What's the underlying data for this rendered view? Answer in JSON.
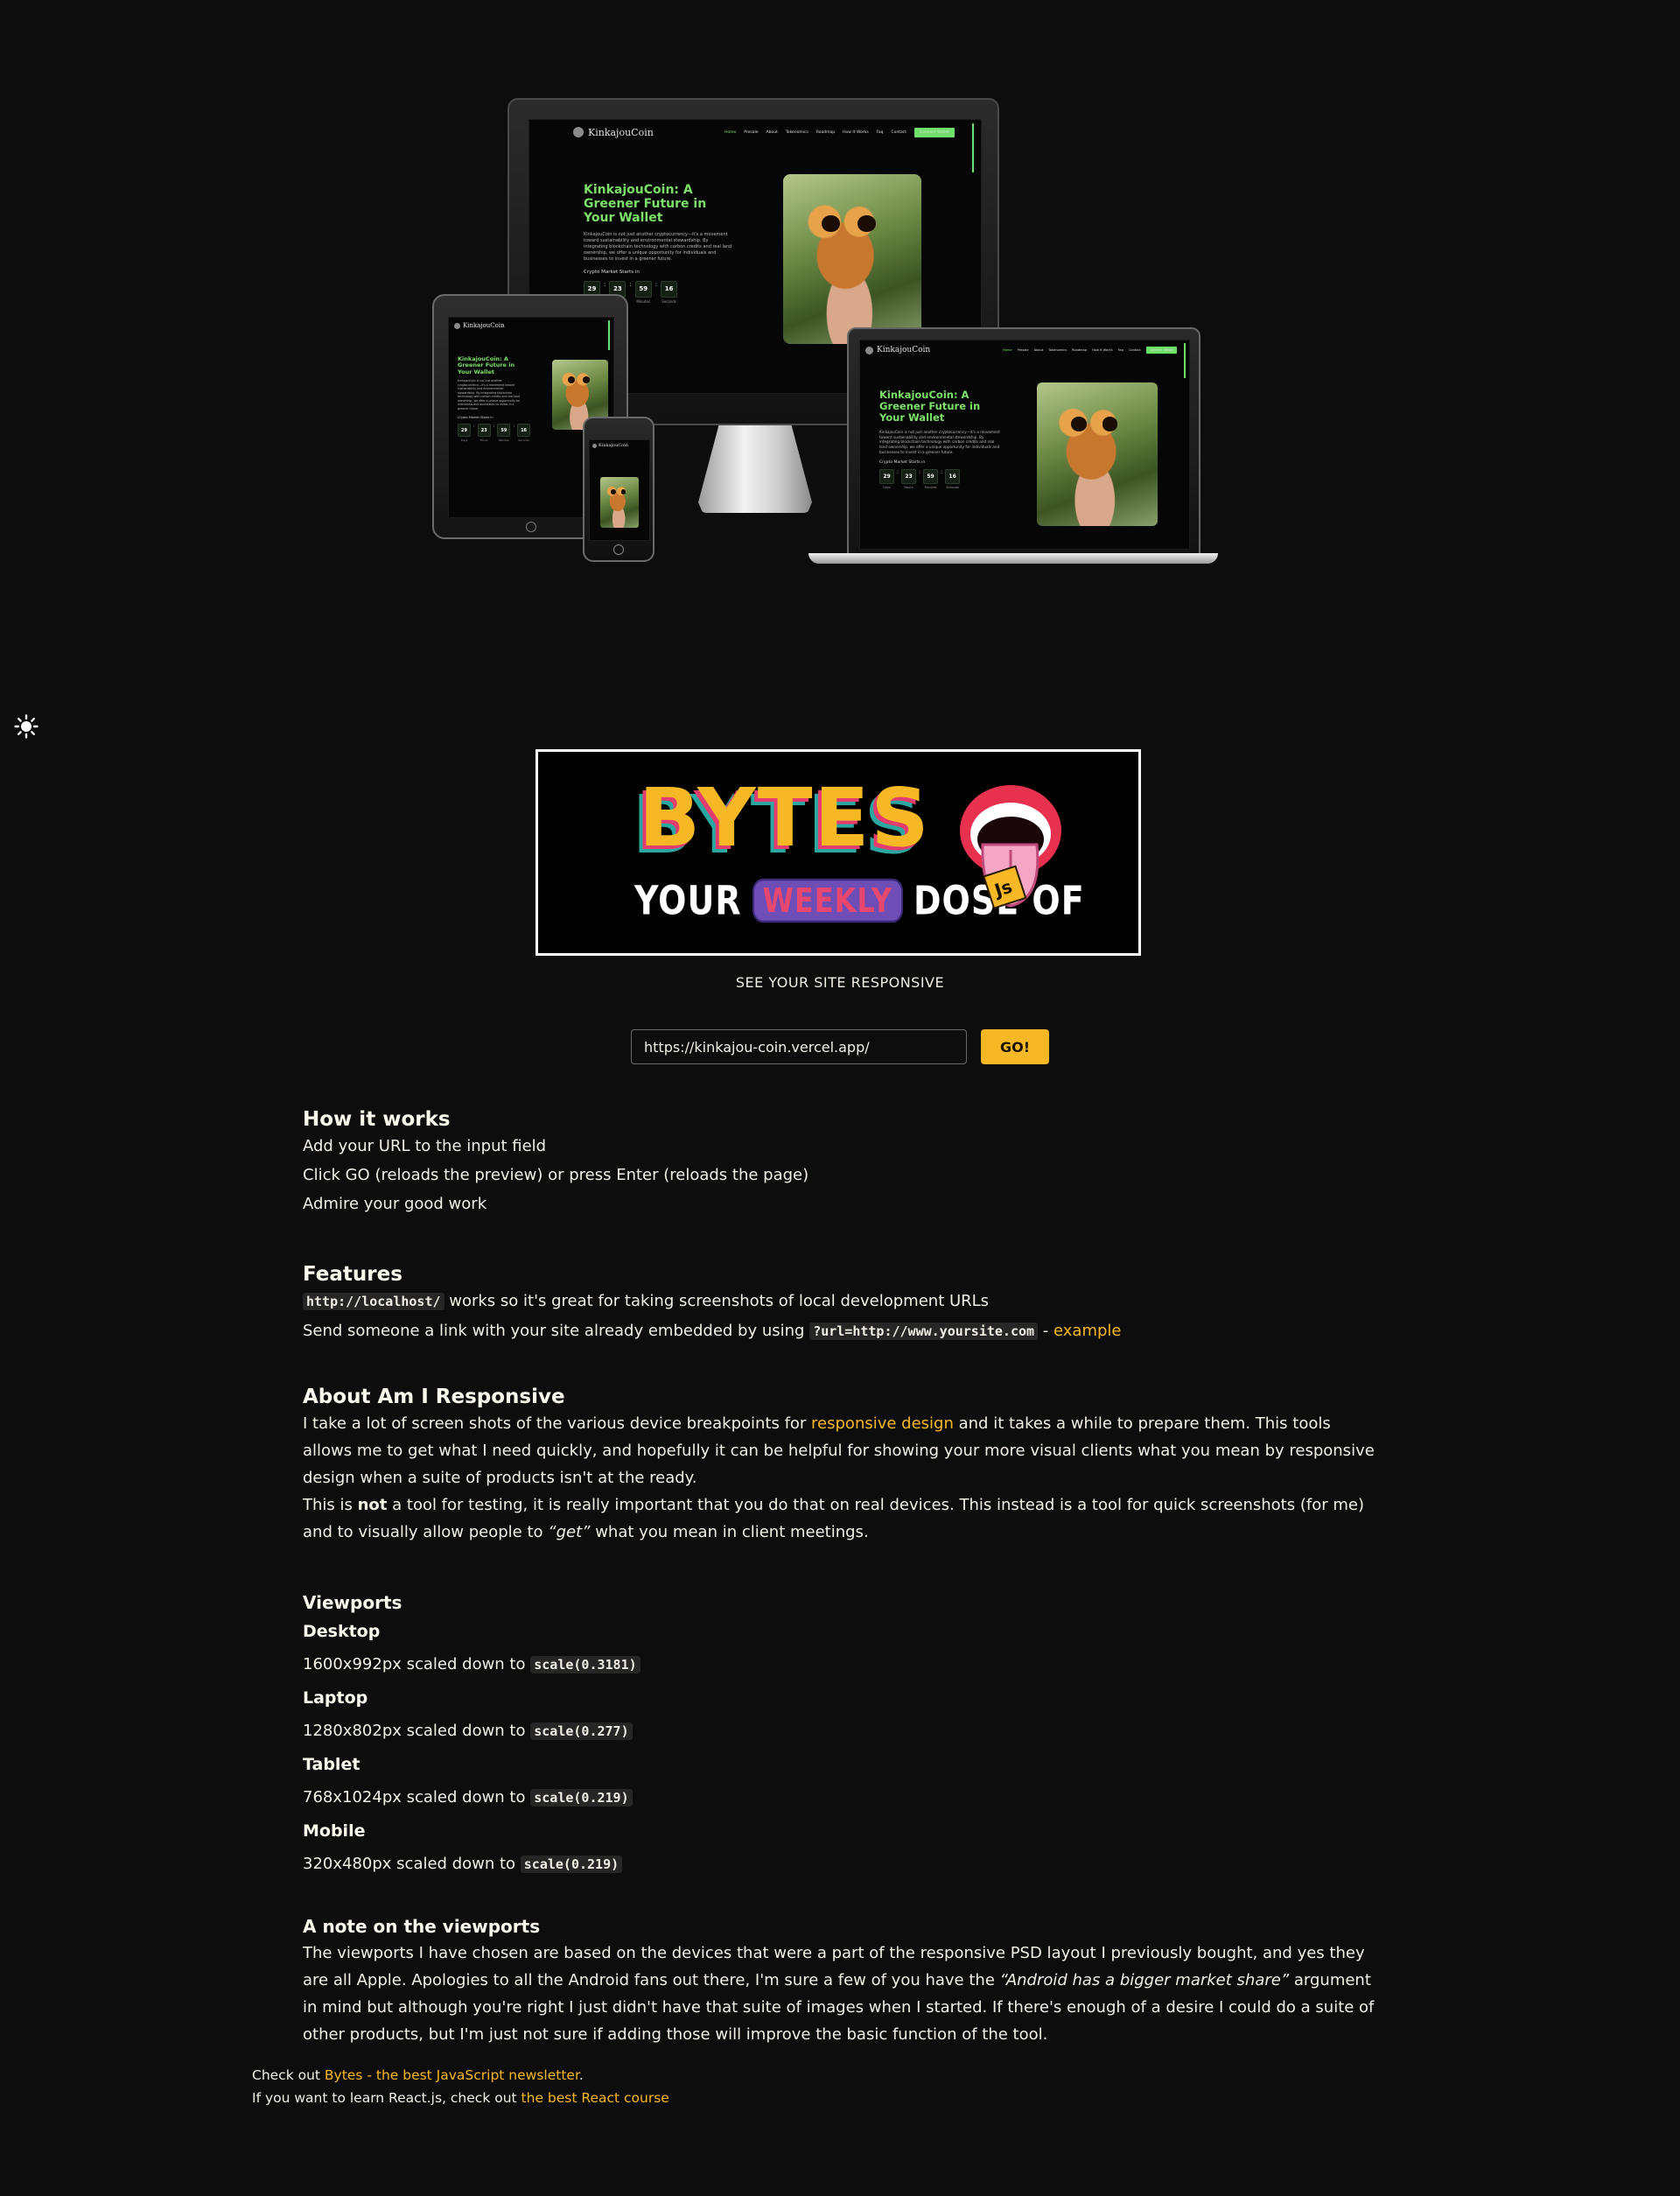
{
  "mockup": {
    "brand": "KinkajouCoin",
    "nav_links": [
      "Home",
      "Presale",
      "About",
      "Tokenomics",
      "Roadmap",
      "How It Works",
      "Faq",
      "Contact"
    ],
    "nav_button": "Connect Wallet",
    "headline_1": "KinkajouCoin: A",
    "headline_2": "Greener Future in",
    "headline_3": "Your Wallet",
    "paragraph": "KinkajouCoin is not just another cryptocurrency—it's a movement toward sustainability and environmental stewardship. By integrating blockchain technology with carbon credits and real land ownership, we offer a unique opportunity for individuals and businesses to invest in a greener future.",
    "countdown_label": "Crypto Market Starts in",
    "countdown": [
      {
        "value": "29",
        "label": "Days"
      },
      {
        "value": "23",
        "label": "Hours"
      },
      {
        "value": "59",
        "label": "Minutes"
      },
      {
        "value": "16",
        "label": "Seconds"
      }
    ]
  },
  "banner": {
    "word": "BYTES",
    "your": "YOUR",
    "weekly": "WEEKLY",
    "dose": "DOSE OF",
    "js": "Js"
  },
  "form": {
    "section_label": "SEE YOUR SITE RESPONSIVE",
    "url_value": "https://kinkajou-coin.vercel.app/",
    "go_label": "GO!"
  },
  "how": {
    "title": "How it works",
    "steps": [
      "Add your URL to the input field",
      "Click GO (reloads the preview) or press Enter (reloads the page)",
      "Admire your good work"
    ]
  },
  "features": {
    "title": "Features",
    "line1_code": "http://localhost/",
    "line1_text": " works so it's great for taking screenshots of local development URLs",
    "line2_text": "Send someone a link with your site already embedded by using ",
    "line2_code": "?url=http://www.yoursite.com",
    "line2_sep": " - ",
    "line2_link": "example"
  },
  "about": {
    "title": "About Am I Responsive",
    "p1_before": "I take a lot of screen shots of the various device breakpoints for ",
    "p1_link": "responsive design",
    "p1_after": " and it takes a while to prepare them. This tools allows me to get what I need quickly, and hopefully it can be helpful for showing your more visual clients what you mean by responsive design when a suite of products isn't at the ready.",
    "p2_before": "This is ",
    "p2_bold": "not",
    "p2_middle": " a tool for testing, it is really important that you do that on real devices. This instead is a tool for quick screenshots (for me) and to visually allow people to ",
    "p2_italic": "“get”",
    "p2_after": " what you mean in client meetings."
  },
  "viewports": {
    "title": "Viewports",
    "items": [
      {
        "name": "Desktop",
        "size": "1600x992px scaled down to ",
        "scale": "scale(0.3181)"
      },
      {
        "name": "Laptop",
        "size": "1280x802px scaled down to ",
        "scale": "scale(0.277)"
      },
      {
        "name": "Tablet",
        "size": "768x1024px scaled down to ",
        "scale": "scale(0.219)"
      },
      {
        "name": "Mobile",
        "size": "320x480px scaled down to ",
        "scale": "scale(0.219)"
      }
    ]
  },
  "note": {
    "title": "A note on the viewports",
    "p_before": "The viewports I have chosen are based on the devices that were a part of the responsive PSD layout I previously bought, and yes they are all Apple. Apologies to all the Android fans out there, I'm sure a few of you have the ",
    "p_italic": "“Android has a bigger market share”",
    "p_after": " argument in mind but although you're right I just didn't have that suite of images when I started. If there's enough of a desire I could do a suite of other products, but I'm just not sure if adding those will improve the basic function of the tool."
  },
  "footer": {
    "line1_before": "Check out ",
    "line1_link": "Bytes - the best JavaScript newsletter",
    "line1_after": ".",
    "line2_before": "If you want to learn React.js, check out ",
    "line2_link": "the best React course"
  },
  "colors": {
    "background": "#0e0d0e",
    "accent": "#f6b824",
    "mockup_green": "#6fe16a"
  }
}
